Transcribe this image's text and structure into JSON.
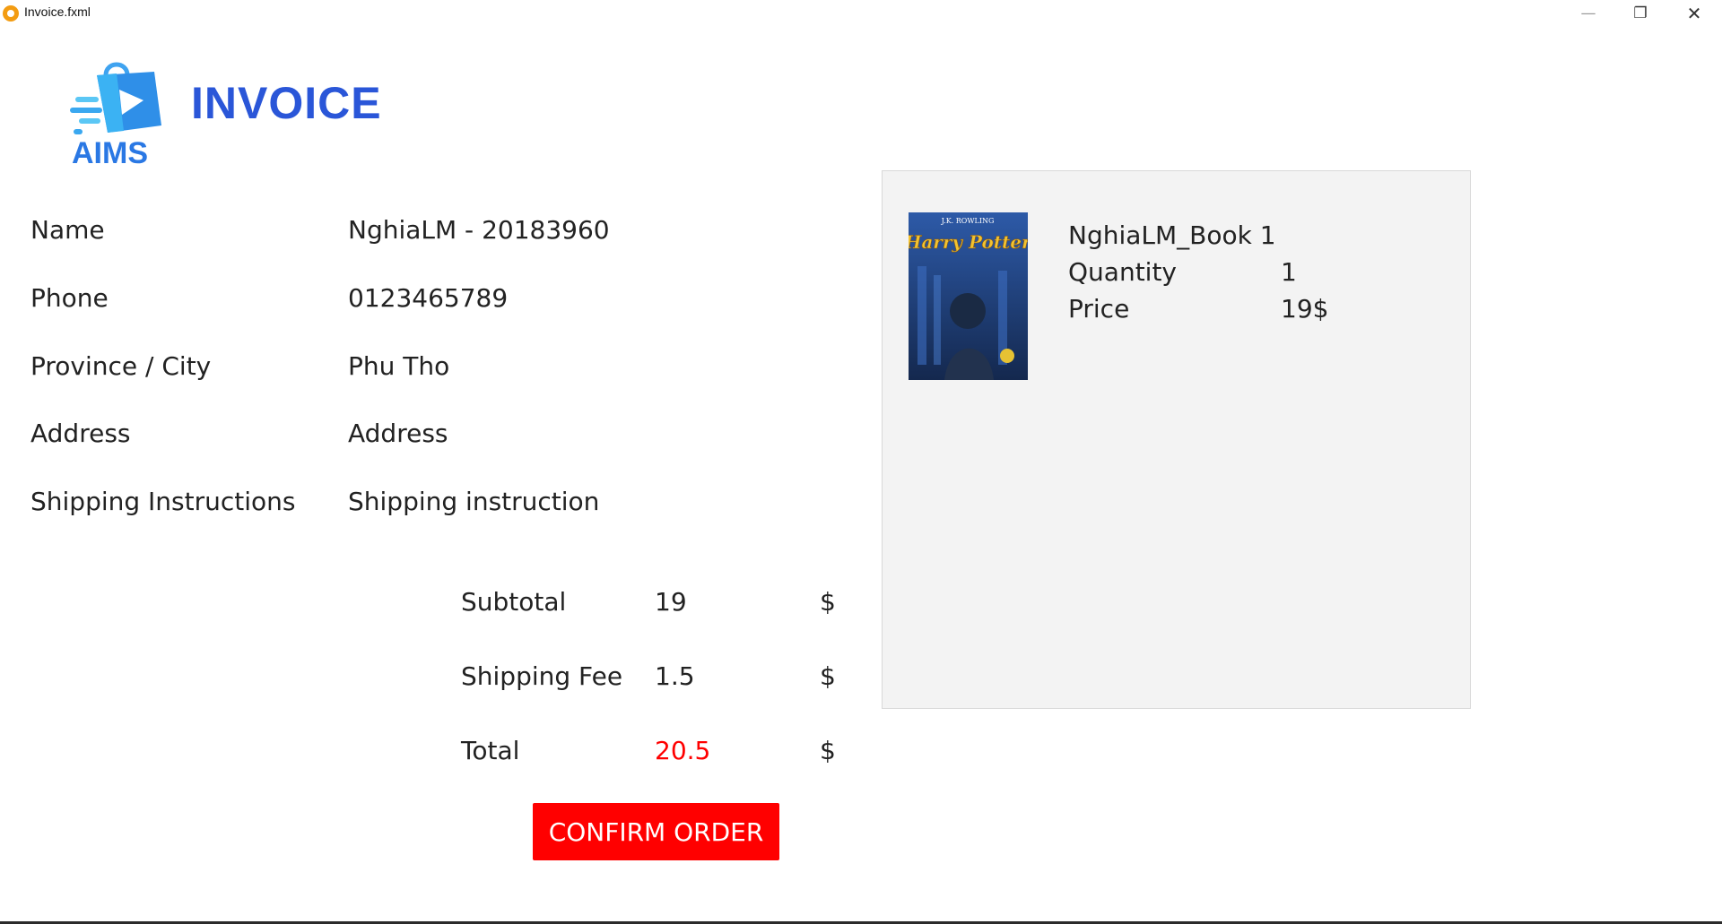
{
  "window": {
    "title": "Invoice.fxml",
    "minimize": "—",
    "maximize": "❐",
    "close": "✕"
  },
  "header": {
    "logo_text": "AIMS",
    "title": "INVOICE"
  },
  "delivery_info": {
    "name_label": "Name",
    "name_value": "NghiaLM - 20183960",
    "phone_label": "Phone",
    "phone_value": "0123465789",
    "province_label": "Province / City",
    "province_value": "Phu Tho",
    "address_label": "Address",
    "address_value": "Address",
    "instructions_label": "Shipping Instructions",
    "instructions_value": "Shipping instruction"
  },
  "totals": {
    "subtotal_label": "Subtotal",
    "subtotal_value": "19",
    "shipping_label": "Shipping Fee",
    "shipping_value": "1.5",
    "total_label": "Total",
    "total_value": "20.5",
    "currency": "$"
  },
  "confirm_label": "CONFIRM ORDER",
  "cart": {
    "items": [
      {
        "name": "NghiaLM_Book 1",
        "quantity_label": "Quantity",
        "quantity_value": "1",
        "price_label": "Price",
        "price_value": "19$",
        "cover": {
          "author": "J.K. ROWLING",
          "title": "Harry Potter"
        }
      }
    ]
  },
  "colors": {
    "title_blue": "#2a56d8",
    "logo_blue": "#2a78e4",
    "accent_red": "#ff0000",
    "panel_bg": "#f3f3f3"
  }
}
